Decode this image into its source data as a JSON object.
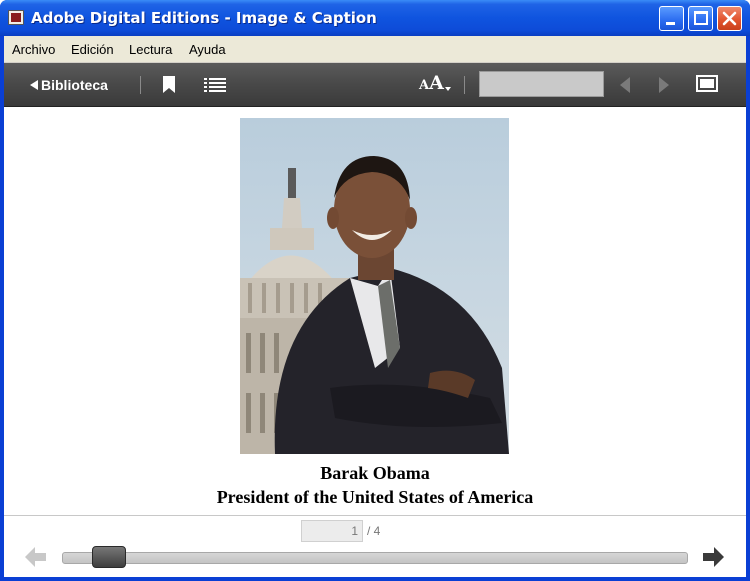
{
  "window": {
    "title": "Adobe Digital Editions - Image & Caption"
  },
  "menu": {
    "items": [
      {
        "label": "Archivo"
      },
      {
        "label": "Edición"
      },
      {
        "label": "Lectura"
      },
      {
        "label": "Ayuda"
      }
    ]
  },
  "toolbar": {
    "library_label": "Biblioteca",
    "font_size_small": "A",
    "font_size_big": "A",
    "search_value": "",
    "search_placeholder": ""
  },
  "content": {
    "image_subject": "Barak Obama portrait in front of capitol dome",
    "caption_name": "Barak Obama",
    "caption_role": "President of the United States of America"
  },
  "pager": {
    "current_page": "1",
    "total_label": "/ 4",
    "current": 1,
    "total": 4
  },
  "colors": {
    "titlebar_blue": "#0f54df",
    "toolbar_gray": "#4a4a4a",
    "close_red": "#e2552f"
  },
  "icons": {
    "back": "triangle-left-icon",
    "bookmark": "bookmark-icon",
    "toc": "list-icon",
    "prev": "arrow-left-icon",
    "next": "arrow-right-icon",
    "fullscreen": "fullscreen-icon"
  }
}
